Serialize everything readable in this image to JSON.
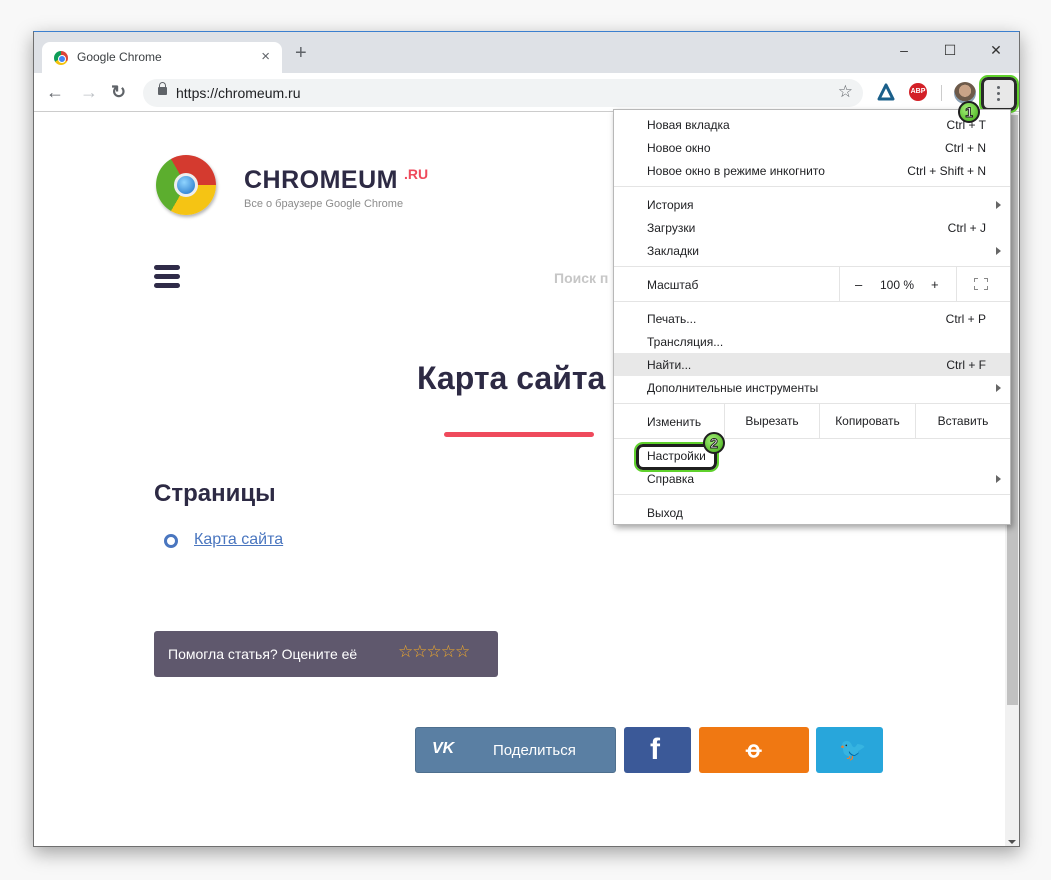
{
  "browser": {
    "tab_title": "Google Chrome",
    "tab_close": "×",
    "new_tab": "+",
    "window_controls": {
      "minimize": "–",
      "maximize": "☐",
      "close": "✕"
    },
    "nav": {
      "back": "←",
      "forward": "→",
      "reload": "↻"
    },
    "url": "https://chromeum.ru",
    "bookmark_star": "☆",
    "abp_label": "ABP"
  },
  "annotations": {
    "step1": "1",
    "step2": "2"
  },
  "site": {
    "brand": "CHROMEUM",
    "brand_suffix": ".RU",
    "tagline": "Все о браузере Google Chrome",
    "search_hint": "Поиск п",
    "page_title": "Карта сайта",
    "section_title": "Страницы",
    "links": [
      "Карта сайта"
    ],
    "rating_prompt": "Помогла статья? Оцените её",
    "rating_stars": "☆☆☆☆☆",
    "rating_value": 0,
    "share": {
      "vk_icon": "VK",
      "vk_label": "Поделиться",
      "fb_icon": "f",
      "ok_icon": "ꝋ",
      "tw_icon": "🐦"
    },
    "colors": {
      "accent": "#ef4a5c",
      "brand_dark": "#2d2a44",
      "link": "#4a76bf"
    }
  },
  "menu": {
    "group1": [
      {
        "label": "Новая вкладка",
        "shortcut": "Ctrl + T"
      },
      {
        "label": "Новое окно",
        "shortcut": "Ctrl + N"
      },
      {
        "label": "Новое окно в режиме инкогнито",
        "shortcut": "Ctrl + Shift + N"
      }
    ],
    "group2": [
      {
        "label": "История",
        "shortcut": ""
      },
      {
        "label": "Загрузки",
        "shortcut": "Ctrl + J"
      },
      {
        "label": "Закладки",
        "shortcut": ""
      }
    ],
    "zoom": {
      "label": "Масштаб",
      "minus": "–",
      "value": "100 %",
      "plus": "+"
    },
    "group3": [
      {
        "label": "Печать...",
        "shortcut": "Ctrl + P"
      },
      {
        "label": "Трансляция...",
        "shortcut": ""
      },
      {
        "label": "Найти...",
        "shortcut": "Ctrl + F"
      },
      {
        "label": "Дополнительные инструменты",
        "shortcut": ""
      }
    ],
    "edit": {
      "label": "Изменить",
      "cut": "Вырезать",
      "copy": "Копировать",
      "paste": "Вставить"
    },
    "group4": [
      {
        "label": "Настройки",
        "shortcut": ""
      },
      {
        "label": "Справка",
        "shortcut": ""
      }
    ],
    "exit": "Выход"
  }
}
